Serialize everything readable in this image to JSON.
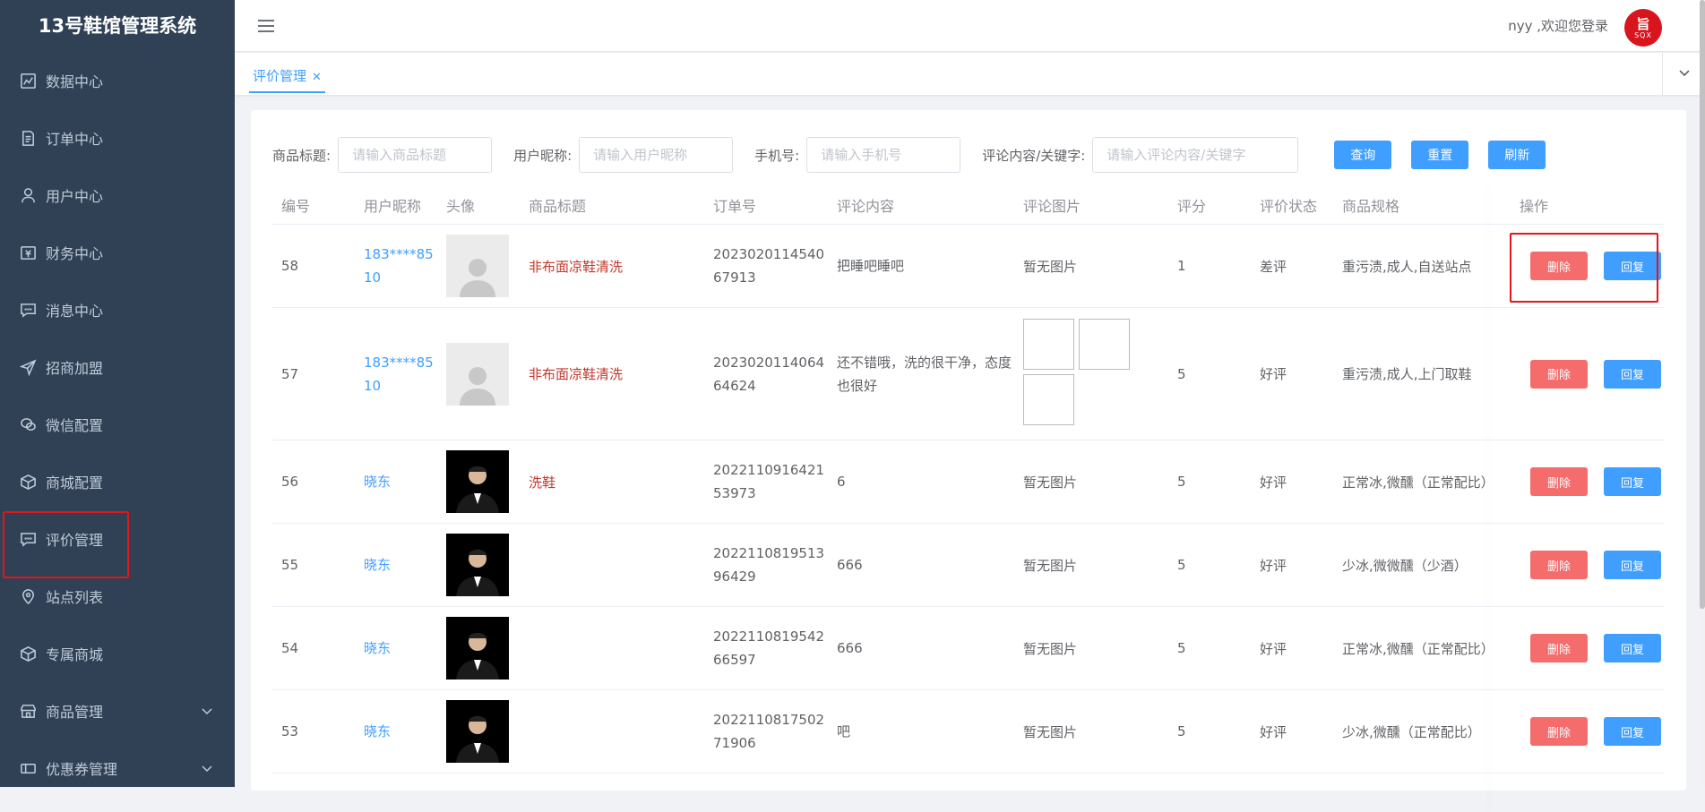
{
  "app": {
    "title": "13号鞋馆管理系统"
  },
  "sidebar": {
    "items": [
      {
        "label": "数据中心",
        "icon": "chart-icon"
      },
      {
        "label": "订单中心",
        "icon": "document-icon"
      },
      {
        "label": "用户中心",
        "icon": "user-icon"
      },
      {
        "label": "财务中心",
        "icon": "money-icon"
      },
      {
        "label": "消息中心",
        "icon": "chat-icon"
      },
      {
        "label": "招商加盟",
        "icon": "send-icon"
      },
      {
        "label": "微信配置",
        "icon": "wechat-icon"
      },
      {
        "label": "商城配置",
        "icon": "box-icon"
      },
      {
        "label": "评价管理",
        "icon": "comment-icon"
      },
      {
        "label": "站点列表",
        "icon": "location-icon"
      },
      {
        "label": "专属商城",
        "icon": "box-icon"
      },
      {
        "label": "商品管理",
        "icon": "shop-icon"
      },
      {
        "label": "优惠券管理",
        "icon": "coupon-icon"
      }
    ]
  },
  "header": {
    "welcome": "nyy ,欢迎您登录",
    "avatar_main": "旨",
    "avatar_sub": "SQX",
    "brand_color": "#d8141c"
  },
  "tabs": [
    {
      "label": "评价管理",
      "close": "✕"
    }
  ],
  "filters": {
    "title_label": "商品标题:",
    "title_placeholder": "请输入商品标题",
    "nick_label": "用户昵称:",
    "nick_placeholder": "请输入用户昵称",
    "phone_label": "手机号:",
    "phone_placeholder": "请输入手机号",
    "kw_label": "评论内容/关键字:",
    "kw_placeholder": "请输入评论内容/关键字",
    "query": "查询",
    "reset": "重置",
    "refresh": "刷新"
  },
  "table": {
    "columns": [
      "编号",
      "用户昵称",
      "头像",
      "商品标题",
      "订单号",
      "评论内容",
      "评论图片",
      "评分",
      "评价状态",
      "商品规格",
      "操作"
    ],
    "delete_label": "删除",
    "reply_label": "回复",
    "rows": [
      {
        "id": "58",
        "nick": "183****8510",
        "avatar": "placeholder",
        "title": "非布面凉鞋清洗",
        "order": "202302011454067913",
        "content": "把睡吧睡吧",
        "pics": "暂无图片",
        "score": "1",
        "status": "差评",
        "spec": "重污渍,成人,自送站点"
      },
      {
        "id": "57",
        "nick": "183****8510",
        "avatar": "placeholder",
        "title": "非布面凉鞋清洗",
        "order": "202302011406464624",
        "content": "还不错哦，洗的很干净，态度也很好",
        "pics": "images",
        "score": "5",
        "status": "好评",
        "spec": "重污渍,成人,上门取鞋"
      },
      {
        "id": "56",
        "nick": "晓东",
        "avatar": "photo",
        "title": "洗鞋",
        "order": "202211091642153973",
        "content": "6",
        "pics": "暂无图片",
        "score": "5",
        "status": "好评",
        "spec": "正常冰,微醺（正常配比）"
      },
      {
        "id": "55",
        "nick": "晓东",
        "avatar": "photo",
        "title": "",
        "order": "202211081951396429",
        "content": "666",
        "pics": "暂无图片",
        "score": "5",
        "status": "好评",
        "spec": "少冰,微微醺（少酒）"
      },
      {
        "id": "54",
        "nick": "晓东",
        "avatar": "photo",
        "title": "",
        "order": "202211081954266597",
        "content": "666",
        "pics": "暂无图片",
        "score": "5",
        "status": "好评",
        "spec": "正常冰,微醺（正常配比）"
      },
      {
        "id": "53",
        "nick": "晓东",
        "avatar": "photo",
        "title": "",
        "order": "202211081750271906",
        "content": "吧",
        "pics": "暂无图片",
        "score": "5",
        "status": "好评",
        "spec": "少冰,微醺（正常配比）"
      }
    ]
  }
}
